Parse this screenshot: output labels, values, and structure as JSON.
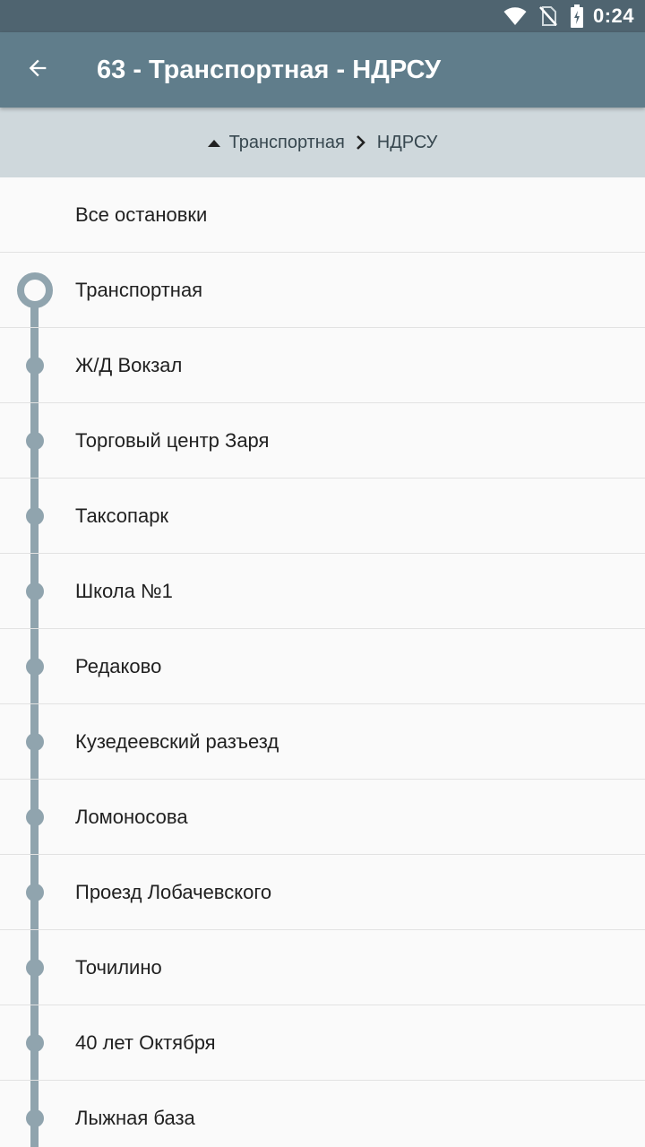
{
  "status_bar": {
    "time": "0:24"
  },
  "app_bar": {
    "title": "63 - Транспортная - НДРСУ"
  },
  "breadcrumb": {
    "from": "Транспортная",
    "to": "НДРСУ"
  },
  "list": {
    "all_stops_label": "Все остановки",
    "stops": [
      "Транспортная",
      "Ж/Д Вокзал",
      "Торговый центр Заря",
      "Таксопарк",
      "Школа №1",
      "Редаково",
      "Кузедеевский разъезд",
      "Ломоносова",
      "Проезд Лобачевского",
      "Точилино",
      "40 лет Октября",
      "Лыжная база"
    ]
  },
  "colors": {
    "status_bar": "#4f6470",
    "app_bar": "#607d8b",
    "breadcrumb_bg": "#cfd8dc",
    "route_line": "#90a4ae"
  }
}
